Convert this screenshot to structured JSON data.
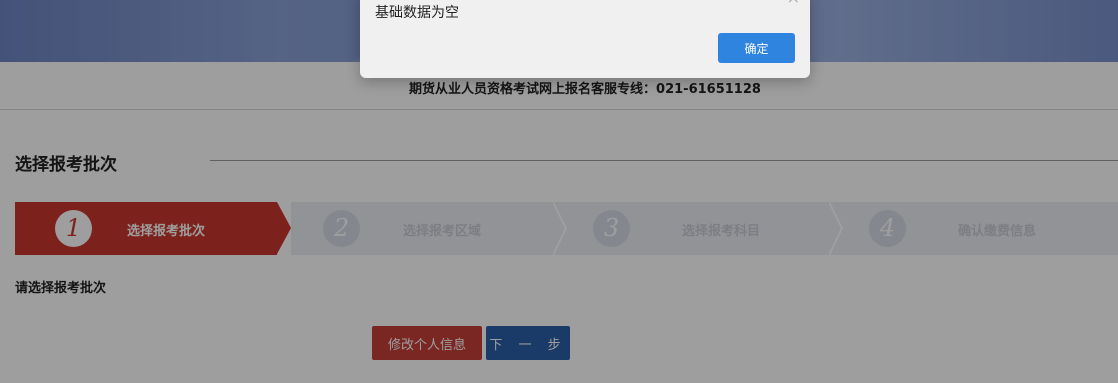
{
  "header": {
    "hotline": "期货从业人员资格考试网上报名客服专线：021-61651128"
  },
  "section": {
    "title": "选择报考批次"
  },
  "steps": [
    {
      "number": "1",
      "label": "选择报考批次",
      "active": true
    },
    {
      "number": "2",
      "label": "选择报考区域",
      "active": false
    },
    {
      "number": "3",
      "label": "选择报考科目",
      "active": false
    },
    {
      "number": "4",
      "label": "确认缴费信息",
      "active": false
    }
  ],
  "prompt": "请选择报考批次",
  "buttons": {
    "edit_info": "修改个人信息",
    "next": "下 一 步"
  },
  "dialog": {
    "message": "基础数据为空",
    "ok_label": "确定",
    "close_glyph": "×"
  },
  "colors": {
    "active_step": "#c8362d",
    "next_button": "#2a5fa8",
    "edit_button": "#c5403a",
    "dialog_ok": "#2f84e0"
  }
}
